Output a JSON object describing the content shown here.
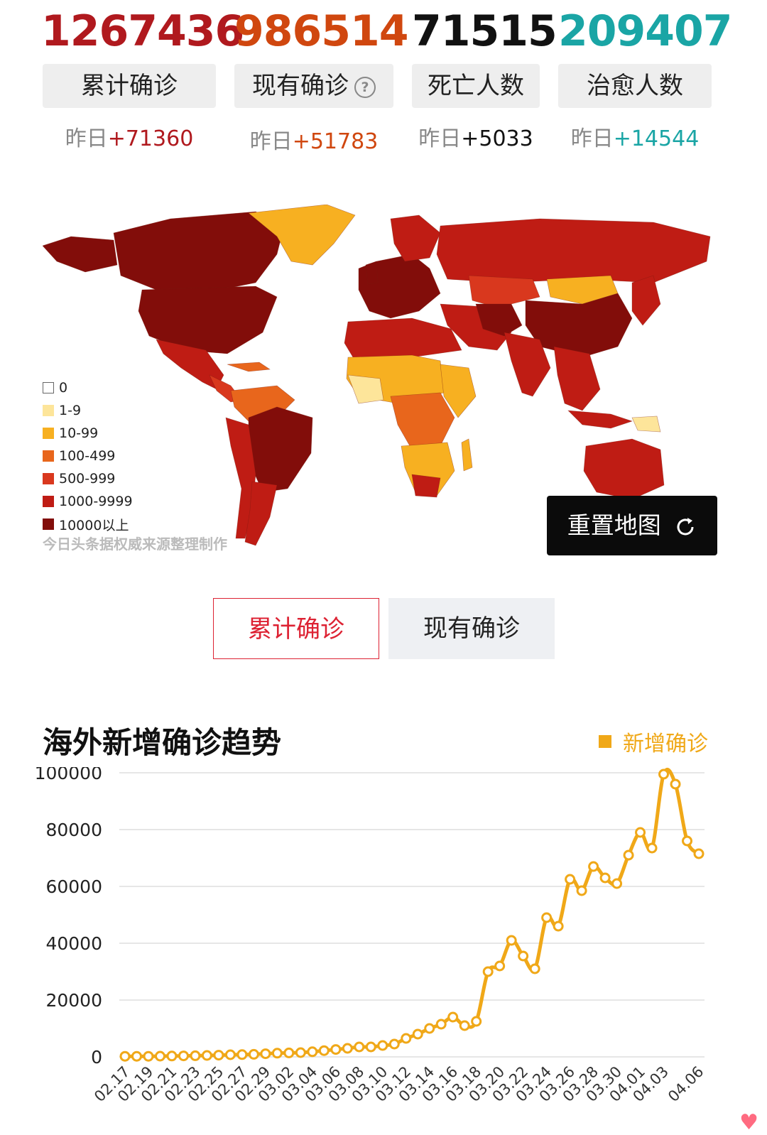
{
  "stats": [
    {
      "number": "1267436",
      "label": "累计确诊",
      "yday_prefix": "昨日",
      "yday_value": "+71360",
      "color": "#b0191e",
      "has_help": false
    },
    {
      "number": "986514",
      "label": "现有确诊",
      "yday_prefix": "昨日",
      "yday_value": "+51783",
      "color": "#d0470f",
      "has_help": true
    },
    {
      "number": "71515",
      "label": "死亡人数",
      "yday_prefix": "昨日",
      "yday_value": "+5033",
      "color": "#111111",
      "has_help": false
    },
    {
      "number": "209407",
      "label": "治愈人数",
      "yday_prefix": "昨日",
      "yday_value": "+14544",
      "color": "#1aa5a5",
      "has_help": false
    }
  ],
  "help_icon": "question-circle-icon",
  "map": {
    "legend": [
      {
        "label": "0",
        "color": "#ffffff"
      },
      {
        "label": "1-9",
        "color": "#fde59a"
      },
      {
        "label": "10-99",
        "color": "#f7b021"
      },
      {
        "label": "100-499",
        "color": "#e8661c"
      },
      {
        "label": "500-999",
        "color": "#d9381e"
      },
      {
        "label": "1000-9999",
        "color": "#bf1c14"
      },
      {
        "label": "10000以上",
        "color": "#820d0a"
      }
    ],
    "source_note": "今日头条据权威来源整理制作",
    "reset_button": "重置地图",
    "reset_icon": "refresh-icon"
  },
  "toggle": {
    "cumulative": "累计确诊",
    "current": "现有确诊"
  },
  "chart_title": "海外新增确诊趋势",
  "chart_data": {
    "type": "line",
    "x": [
      "02.17",
      "02.18",
      "02.19",
      "02.20",
      "02.21",
      "02.22",
      "02.23",
      "02.24",
      "02.25",
      "02.26",
      "02.27",
      "02.28",
      "02.29",
      "03.01",
      "03.02",
      "03.03",
      "03.04",
      "03.05",
      "03.06",
      "03.07",
      "03.08",
      "03.09",
      "03.10",
      "03.11",
      "03.12",
      "03.13",
      "03.14",
      "03.15",
      "03.16",
      "03.17",
      "03.18",
      "03.19",
      "03.20",
      "03.21",
      "03.22",
      "03.23",
      "03.24",
      "03.25",
      "03.26",
      "03.27",
      "03.28",
      "03.29",
      "03.30",
      "03.31",
      "04.01",
      "04.02",
      "04.03",
      "04.04",
      "04.05",
      "04.06"
    ],
    "x_tick_labels": [
      "02.17",
      "02.19",
      "02.21",
      "02.23",
      "02.25",
      "02.27",
      "02.29",
      "03.02",
      "03.04",
      "03.06",
      "03.08",
      "03.10",
      "03.12",
      "03.14",
      "03.16",
      "03.18",
      "03.20",
      "03.22",
      "03.24",
      "03.26",
      "03.28",
      "03.30",
      "04.01",
      "04.03",
      "04.06"
    ],
    "series": [
      {
        "name": "新增确诊",
        "color": "#f0a818",
        "values": [
          200,
          200,
          200,
          250,
          300,
          350,
          400,
          500,
          600,
          750,
          800,
          900,
          1100,
          1300,
          1400,
          1500,
          1800,
          2200,
          2600,
          3000,
          3500,
          3500,
          4000,
          4500,
          6500,
          8000,
          10000,
          11500,
          14000,
          11000,
          12500,
          30000,
          32000,
          41000,
          35500,
          31000,
          49000,
          46000,
          62500,
          58500,
          67000,
          63000,
          61000,
          71000,
          79000,
          73500,
          99500,
          96000,
          76000,
          71500
        ]
      }
    ],
    "ylim": [
      0,
      100000
    ],
    "y_ticks": [
      0,
      20000,
      40000,
      60000,
      80000,
      100000
    ],
    "grid": true,
    "legend_position": "top-right"
  }
}
